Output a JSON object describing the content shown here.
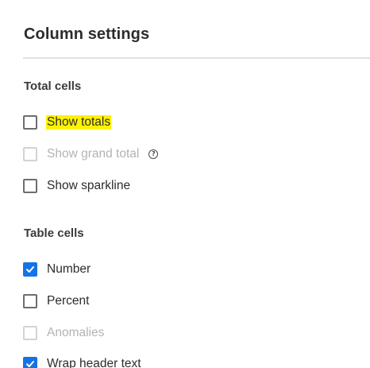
{
  "panel": {
    "title": "Column settings"
  },
  "sections": {
    "total_cells": {
      "heading": "Total cells",
      "items": [
        {
          "label": "Show totals",
          "checked": false,
          "disabled": false,
          "highlighted": true
        },
        {
          "label": "Show grand total",
          "checked": false,
          "disabled": true,
          "help_icon": "help-circle-icon",
          "help_glyph": "?"
        },
        {
          "label": "Show sparkline",
          "checked": false,
          "disabled": false
        }
      ]
    },
    "table_cells": {
      "heading": "Table cells",
      "items": [
        {
          "label": "Number",
          "checked": true,
          "disabled": false
        },
        {
          "label": "Percent",
          "checked": false,
          "disabled": false
        },
        {
          "label": "Anomalies",
          "checked": false,
          "disabled": true
        },
        {
          "label": "Wrap header text",
          "checked": true,
          "disabled": false
        }
      ]
    }
  },
  "colors": {
    "accent": "#1473e6",
    "highlight": "#fff200",
    "disabled_text": "#b3b3b3",
    "divider": "#e1e1e1"
  }
}
